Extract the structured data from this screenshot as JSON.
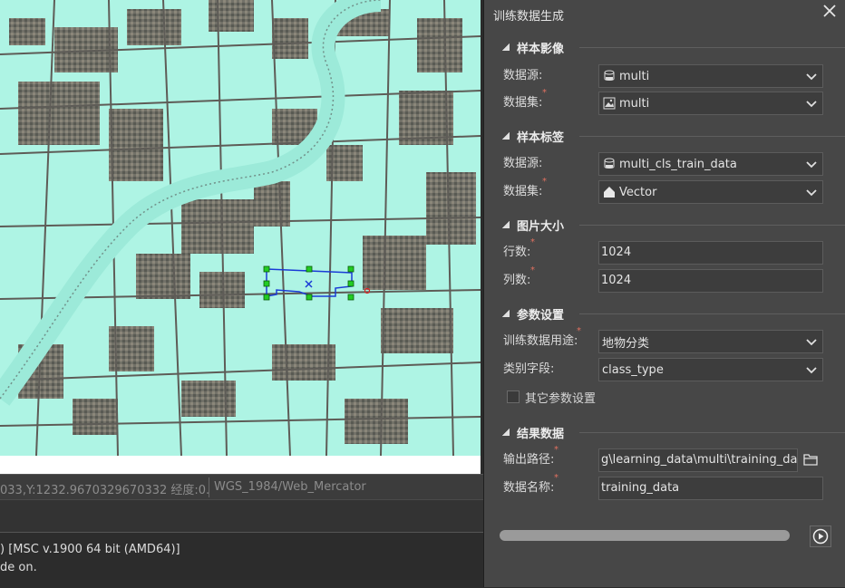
{
  "status": {
    "coord_text": "033,Y:1232.9670329670332  经度:0.",
    "crs_text": "WGS_1984/Web_Mercator"
  },
  "console": {
    "line1": ") [MSC v.1900 64 bit (AMD64)]",
    "line2": "de on."
  },
  "panel": {
    "title": "训练数据生成",
    "sections": {
      "sample_image": {
        "title": "样本影像",
        "datasource_label": "数据源:",
        "datasource_value": "multi",
        "dataset_label": "数据集:",
        "dataset_value": "multi"
      },
      "sample_label": {
        "title": "样本标签",
        "datasource_label": "数据源:",
        "datasource_value": "multi_cls_train_data",
        "dataset_label": "数据集:",
        "dataset_value": "Vector"
      },
      "image_size": {
        "title": "图片大小",
        "rows_label": "行数:",
        "rows_value": "1024",
        "cols_label": "列数:",
        "cols_value": "1024"
      },
      "params": {
        "title": "参数设置",
        "usage_label": "训练数据用途:",
        "usage_value": "地物分类",
        "field_label": "类别字段:",
        "field_value": "class_type",
        "other_label": "其它参数设置"
      },
      "result": {
        "title": "结果数据",
        "path_label": "输出路径:",
        "path_value": "g\\learning_data\\multi\\training_data",
        "name_label": "数据名称:",
        "name_value": "training_data"
      }
    },
    "progress_value": 0
  },
  "colors": {
    "map_background": "#aef4e4",
    "panel_background": "#474747",
    "selection_blue": "#1a3bd6",
    "handle_green": "#22cc22"
  }
}
